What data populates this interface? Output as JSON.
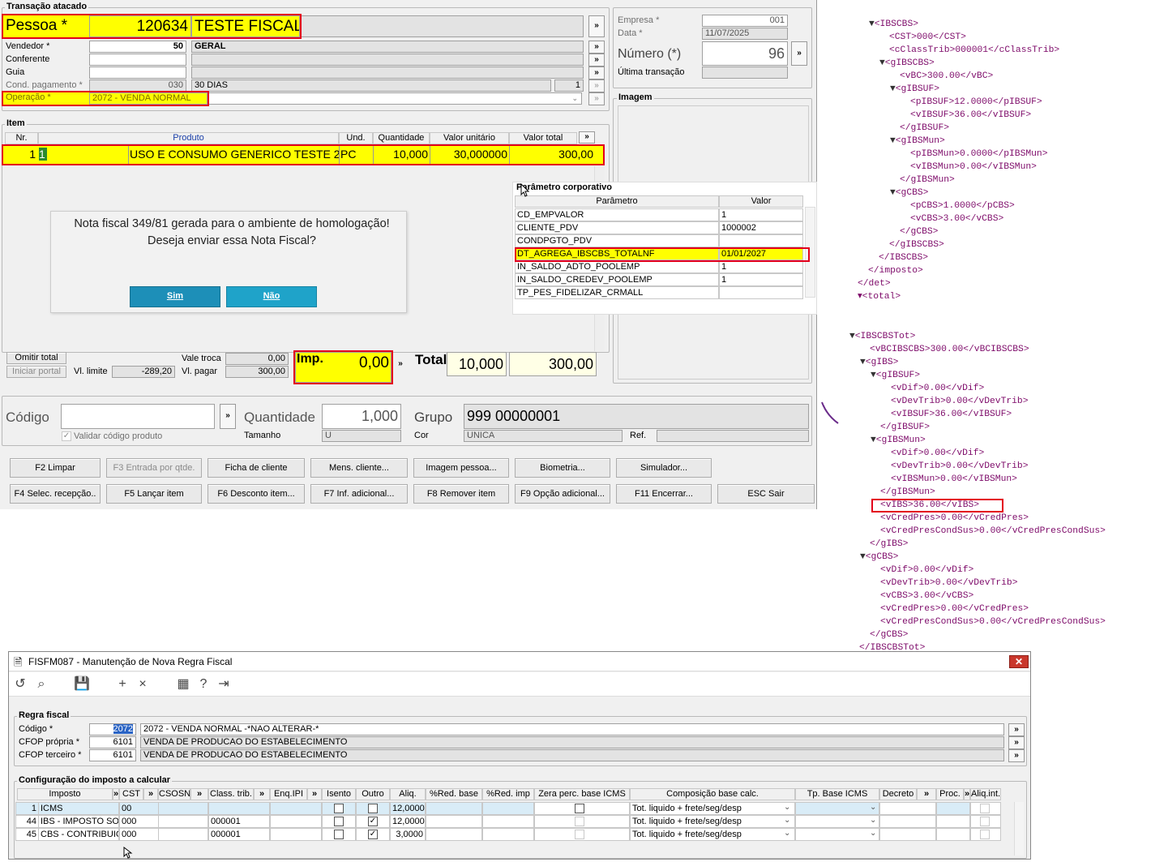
{
  "transacao": {
    "title": "Transação atacado",
    "pessoa_label": "Pessoa *",
    "pessoa_code": "120634",
    "pessoa_name": "TESTE FISCAL",
    "vendedor_label": "Vendedor *",
    "vendedor_code": "50",
    "vendedor_name": "GERAL",
    "conferente_label": "Conferente",
    "guia_label": "Guia",
    "cond_label": "Cond. pagamento *",
    "cond_code": "030",
    "cond_name": "30 DIAS",
    "cond_qty": "1",
    "operacao_label": "Operação *",
    "operacao_value": "2072 - VENDA NORMAL",
    "empresa_label": "Empresa *",
    "empresa_value": "001",
    "data_label": "Data *",
    "data_value": "11/07/2025",
    "numero_label": "Número (*)",
    "numero_value": "96",
    "ultima_label": "Última transação",
    "imagem_label": "Imagem",
    "more": "»"
  },
  "item": {
    "title": "Item",
    "headers": [
      "Nr.",
      "Produto",
      "Und.",
      "Quantidade",
      "Valor unitário",
      "Valor total"
    ],
    "row": {
      "nr": "1",
      "code": "1",
      "produto": "USO E CONSUMO GENERICO TESTE 2",
      "und": "PC",
      "qtd": "10,000",
      "unit": "30,000000",
      "total": "300,00"
    }
  },
  "dialog": {
    "line1": "Nota fiscal 349/81 gerada para o ambiente de homologação!",
    "line2": "Deseja enviar essa Nota Fiscal?",
    "yes": "Sim",
    "no": "Não"
  },
  "param": {
    "title": "Parâmetro corporativo",
    "col_param": "Parâmetro",
    "col_valor": "Valor",
    "rows": [
      {
        "p": "CD_EMPVALOR",
        "v": "1"
      },
      {
        "p": "CLIENTE_PDV",
        "v": "1000002"
      },
      {
        "p": "CONDPGTO_PDV",
        "v": ""
      },
      {
        "p": "DT_AGREGA_IBSCBS_TOTALNF",
        "v": "01/01/2027"
      },
      {
        "p": "IN_SALDO_ADTO_POOLEMP",
        "v": "1"
      },
      {
        "p": "IN_SALDO_CREDEV_POOLEMP",
        "v": "1"
      },
      {
        "p": "TP_PES_FIDELIZAR_CRMALL",
        "v": ""
      }
    ]
  },
  "totals": {
    "omitir": "Omitir total",
    "iniciar": "Iniciar portal",
    "vl_limite_label": "Vl. limite",
    "vl_limite": "-289,20",
    "vale_troca_label": "Vale troca",
    "vale_troca": "0,00",
    "vl_pagar_label": "Vl. pagar",
    "vl_pagar": "300,00",
    "imp_label": "Imp.",
    "imp_value": "0,00",
    "total_label": "Total",
    "total_qty": "10,000",
    "total_value": "300,00"
  },
  "codigo": {
    "codigo_label": "Código",
    "validar_label": "Validar código produto",
    "quantidade_label": "Quantidade",
    "quantidade_value": "1,000",
    "tamanho_label": "Tamanho",
    "tamanho_value": "U",
    "grupo_label": "Grupo",
    "grupo_value": "999 00000001",
    "cor_label": "Cor",
    "cor_value": "UNICA",
    "ref_label": "Ref."
  },
  "buttons_row1": [
    "F2 Limpar",
    "F3 Entrada por qtde.",
    "Ficha de cliente",
    "Mens. cliente...",
    "Imagem pessoa...",
    "Biometria...",
    "Simulador..."
  ],
  "buttons_row2": [
    "F4 Selec. recepção..",
    "F5 Lançar item",
    "F6 Desconto item...",
    "F7 Inf. adicional...",
    "F8 Remover item",
    "F9 Opção adicional...",
    "F11 Encerrar...",
    "ESC Sair"
  ],
  "xml_lines": [
    {
      "i": 0,
      "t": "▼",
      "s": "<IBSCBS>"
    },
    {
      "i": 1,
      "t": "",
      "s": "<CST>000</CST>"
    },
    {
      "i": 1,
      "t": "",
      "s": "<cClassTrib>000001</cClassTrib>"
    },
    {
      "i": 1,
      "t": "▼",
      "s": "<gIBSCBS>"
    },
    {
      "i": 2,
      "t": "",
      "s": "<vBC>300.00</vBC>"
    },
    {
      "i": 2,
      "t": "▼",
      "s": "<gIBSUF>"
    },
    {
      "i": 3,
      "t": "",
      "s": "<pIBSUF>12.0000</pIBSUF>"
    },
    {
      "i": 3,
      "t": "",
      "s": "<vIBSUF>36.00</vIBSUF>"
    },
    {
      "i": 2,
      "t": "",
      "s": "</gIBSUF>"
    },
    {
      "i": 2,
      "t": "▼",
      "s": "<gIBSMun>"
    },
    {
      "i": 3,
      "t": "",
      "s": "<pIBSMun>0.0000</pIBSMun>"
    },
    {
      "i": 3,
      "t": "",
      "s": "<vIBSMun>0.00</vIBSMun>"
    },
    {
      "i": 2,
      "t": "",
      "s": "</gIBSMun>"
    },
    {
      "i": 2,
      "t": "▼",
      "s": "<gCBS>"
    },
    {
      "i": 3,
      "t": "",
      "s": "<pCBS>1.0000</pCBS>"
    },
    {
      "i": 3,
      "t": "",
      "s": "<vCBS>3.00</vCBS>"
    },
    {
      "i": 2,
      "t": "",
      "s": "</gCBS>"
    },
    {
      "i": 1,
      "t": "",
      "s": "</gIBSCBS>"
    },
    {
      "i": 0,
      "t": "",
      "s": "</IBSCBS>"
    },
    {
      "i": -1,
      "t": "",
      "s": "</imposto>"
    },
    {
      "i": -2,
      "t": "",
      "s": "</det>"
    },
    {
      "i": -2,
      "t": "",
      "s": "▾<total>"
    }
  ],
  "xml_lines2": [
    {
      "i": 0,
      "t": "▼",
      "s": "<IBSCBSTot>"
    },
    {
      "i": 1,
      "t": "",
      "s": "<vBCIBSCBS>300.00</vBCIBSCBS>"
    },
    {
      "i": 1,
      "t": "▼",
      "s": "<gIBS>"
    },
    {
      "i": 2,
      "t": "▼",
      "s": "<gIBSUF>"
    },
    {
      "i": 3,
      "t": "",
      "s": "<vDif>0.00</vDif>"
    },
    {
      "i": 3,
      "t": "",
      "s": "<vDevTrib>0.00</vDevTrib>"
    },
    {
      "i": 3,
      "t": "",
      "s": "<vIBSUF>36.00</vIBSUF>"
    },
    {
      "i": 2,
      "t": "",
      "s": "</gIBSUF>"
    },
    {
      "i": 2,
      "t": "▼",
      "s": "<gIBSMun>"
    },
    {
      "i": 3,
      "t": "",
      "s": "<vDif>0.00</vDif>"
    },
    {
      "i": 3,
      "t": "",
      "s": "<vDevTrib>0.00</vDevTrib>"
    },
    {
      "i": 3,
      "t": "",
      "s": "<vIBSMun>0.00</vIBSMun>"
    },
    {
      "i": 2,
      "t": "",
      "s": "</gIBSMun>"
    },
    {
      "i": 2,
      "t": "",
      "s": "<vIBS>36.00</vIBS>"
    },
    {
      "i": 2,
      "t": "",
      "s": "<vCredPres>0.00</vCredPres>"
    },
    {
      "i": 2,
      "t": "",
      "s": "<vCredPresCondSus>0.00</vCredPresCondSus>"
    },
    {
      "i": 1,
      "t": "",
      "s": "</gIBS>"
    },
    {
      "i": 1,
      "t": "▼",
      "s": "<gCBS>"
    },
    {
      "i": 2,
      "t": "",
      "s": "<vDif>0.00</vDif>"
    },
    {
      "i": 2,
      "t": "",
      "s": "<vDevTrib>0.00</vDevTrib>"
    },
    {
      "i": 2,
      "t": "",
      "s": "<vCBS>3.00</vCBS>"
    },
    {
      "i": 2,
      "t": "",
      "s": "<vCredPres>0.00</vCredPres>"
    },
    {
      "i": 2,
      "t": "",
      "s": "<vCredPresCondSus>0.00</vCredPresCondSus>"
    },
    {
      "i": 1,
      "t": "",
      "s": "</gCBS>"
    },
    {
      "i": 0,
      "t": "",
      "s": "</IBSCBSTot>"
    }
  ],
  "fisfm": {
    "title": "FISFM087 - Manutenção de Nova Regra Fiscal",
    "regra_title": "Regra fiscal",
    "codigo_label": "Código *",
    "codigo_value": "2072",
    "codigo_desc": "2072 - VENDA NORMAL -*NAO ALTERAR-*",
    "cfop_propria_label": "CFOP própria *",
    "cfop_propria_value": "6101",
    "cfop_propria_desc": "VENDA DE PRODUCAO DO ESTABELECIMENTO",
    "cfop_terceiro_label": "CFOP terceiro *",
    "cfop_terceiro_value": "6101",
    "cfop_terceiro_desc": "VENDA DE PRODUCAO DO ESTABELECIMENTO",
    "config_title": "Configuração do imposto a calcular",
    "headers": [
      "Imposto",
      "CST",
      "CSOSN",
      "Class. trib.",
      "Enq.IPI",
      "Isento",
      "Outro",
      "Aliq.",
      "%Red. base",
      "%Red. imp",
      "Zera perc. base ICMS",
      "Composição base calc.",
      "Tp. Base ICMS",
      "Decreto",
      "Proc.",
      "Aliq.int."
    ],
    "rows": [
      {
        "n": "1",
        "imposto": "ICMS",
        "cst": "00",
        "class": "",
        "aliq": "12,0000",
        "comp": "Tot. liquido + frete/seg/desp",
        "outro": false
      },
      {
        "n": "44",
        "imposto": "IBS - IMPOSTO SOBRE",
        "cst": "000",
        "class": "000001",
        "aliq": "12,0000",
        "comp": "Tot. liquido + frete/seg/desp",
        "outro": true
      },
      {
        "n": "45",
        "imposto": "CBS - CONTRIBUIÇÃO",
        "cst": "000",
        "class": "000001",
        "aliq": "3,0000",
        "comp": "Tot. liquido + frete/seg/desp",
        "outro": true
      }
    ]
  }
}
